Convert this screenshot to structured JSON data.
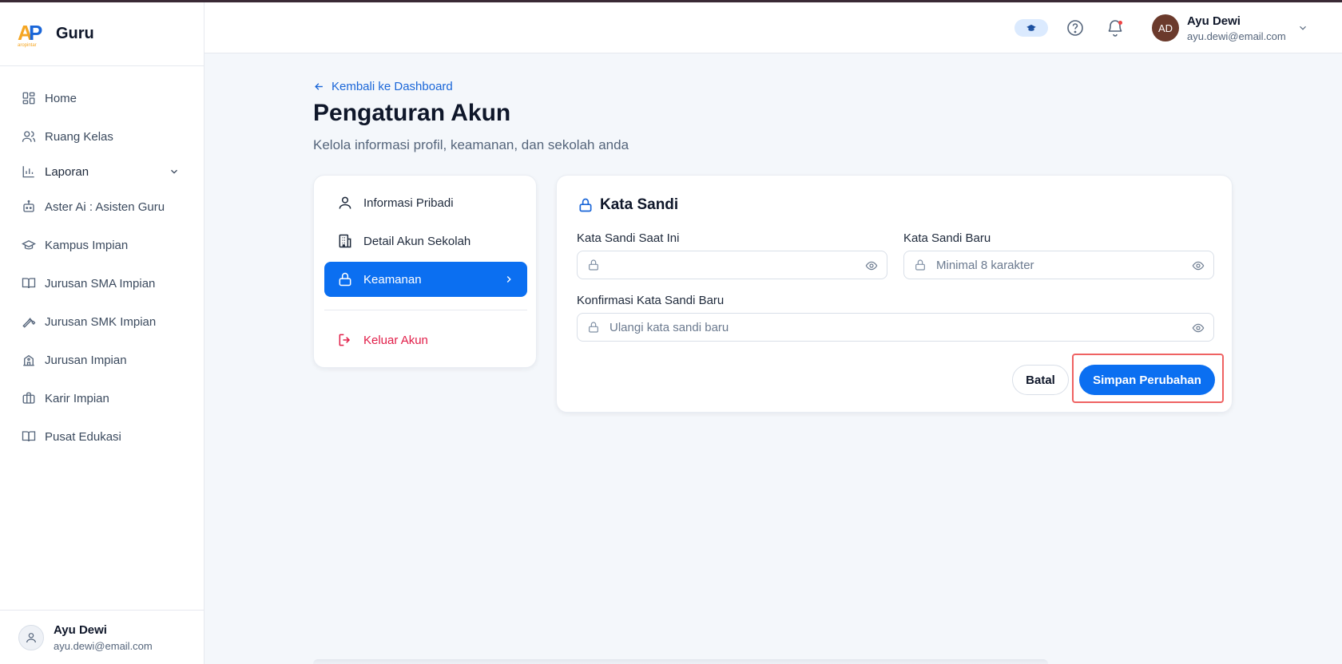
{
  "brand": {
    "logo_text": "AP",
    "logo_sub": "aropintar",
    "title": "Guru"
  },
  "sidebar": {
    "items": [
      {
        "label": "Home",
        "icon": "grid-icon"
      },
      {
        "label": "Ruang Kelas",
        "icon": "users-icon"
      },
      {
        "label": "Laporan",
        "icon": "bar-chart-icon",
        "expandable": true
      },
      {
        "label": "Aster Ai : Asisten Guru",
        "icon": "robot-icon"
      },
      {
        "label": "Kampus Impian",
        "icon": "graduation-cap-icon"
      },
      {
        "label": "Jurusan SMA Impian",
        "icon": "book-open-icon"
      },
      {
        "label": "Jurusan SMK Impian",
        "icon": "wrench-icon"
      },
      {
        "label": "Jurusan Impian",
        "icon": "school-icon"
      },
      {
        "label": "Karir Impian",
        "icon": "briefcase-icon"
      },
      {
        "label": "Pusat Edukasi",
        "icon": "book-icon"
      }
    ],
    "user": {
      "name": "Ayu Dewi",
      "email": "ayu.dewi@email.com"
    }
  },
  "header": {
    "user": {
      "initials": "AD",
      "name": "Ayu Dewi",
      "email": "ayu.dewi@email.com"
    }
  },
  "main": {
    "back_label": "Kembali ke Dashboard",
    "title": "Pengaturan Akun",
    "subtitle": "Kelola informasi profil, keamanan, dan sekolah anda",
    "menu": {
      "personal": "Informasi Pribadi",
      "school": "Detail Akun Sekolah",
      "security": "Keamanan",
      "logout": "Keluar Akun"
    },
    "form": {
      "title": "Kata Sandi",
      "current_label": "Kata Sandi Saat Ini",
      "current_placeholder": "",
      "new_label": "Kata Sandi Baru",
      "new_placeholder": "Minimal 8 karakter",
      "confirm_label": "Konfirmasi Kata Sandi Baru",
      "confirm_placeholder": "Ulangi kata sandi baru",
      "cancel_label": "Batal",
      "save_label": "Simpan Perubahan"
    }
  },
  "colors": {
    "accent": "#0b6ff1",
    "danger": "#e11d48",
    "highlight": "#ef6262"
  }
}
